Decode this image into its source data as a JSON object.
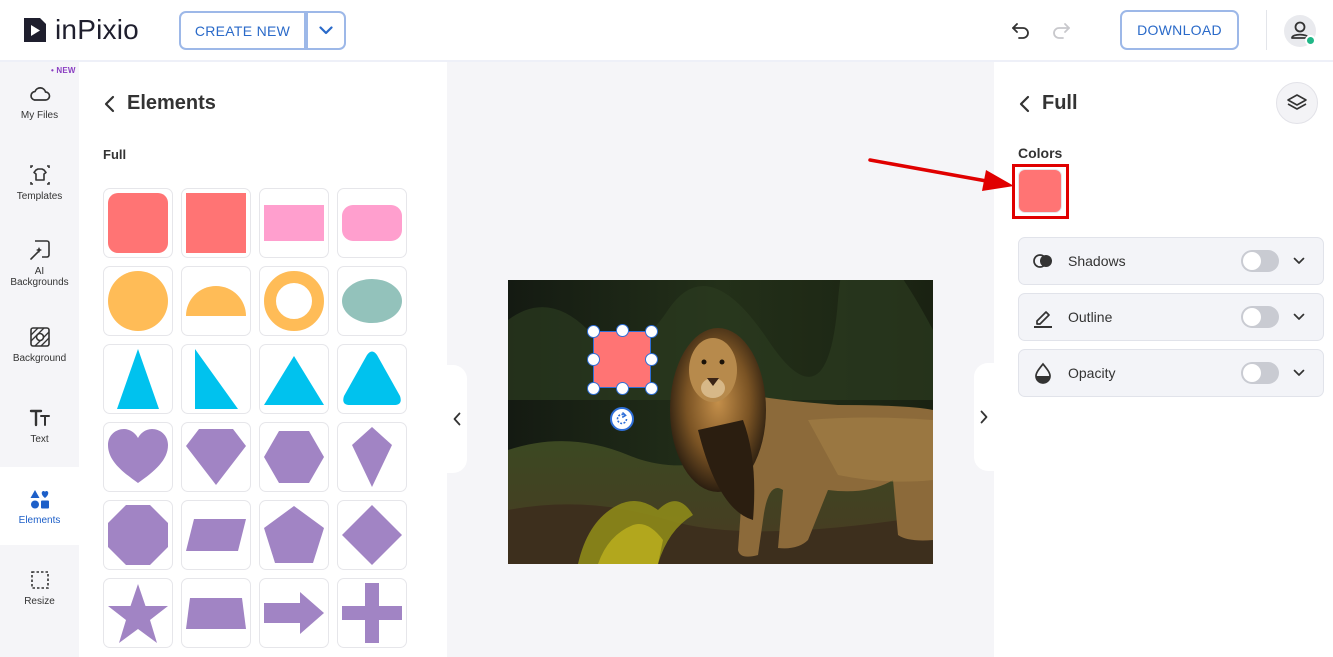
{
  "app": {
    "name": "inPixio"
  },
  "header": {
    "create_new_label": "CREATE NEW",
    "download_label": "DOWNLOAD"
  },
  "rail": {
    "new_badge": "• NEW",
    "items": [
      {
        "label": "My Files",
        "icon": "cloud-icon"
      },
      {
        "label": "Templates",
        "icon": "template-shirt-icon"
      },
      {
        "label": "AI Backgrounds",
        "icon": "ai-background-icon"
      },
      {
        "label": "Background",
        "icon": "background-icon"
      },
      {
        "label": "Text",
        "icon": "text-icon"
      },
      {
        "label": "Elements",
        "icon": "shapes-icon",
        "active": true
      },
      {
        "label": "Resize",
        "icon": "resize-icon"
      }
    ]
  },
  "elements_panel": {
    "title": "Elements",
    "section": "Full"
  },
  "props_panel": {
    "title": "Full",
    "colors_label": "Colors",
    "selected_color": "#ff7474",
    "options": [
      {
        "label": "Shadows",
        "enabled": false
      },
      {
        "label": "Outline",
        "enabled": false
      },
      {
        "label": "Opacity",
        "enabled": false
      }
    ]
  },
  "colors": {
    "accent": "#2a6ac9",
    "coral": "#ff7474",
    "pink": "#ff9fce",
    "orange": "#ffbc57",
    "teal": "#93c2bb",
    "cyan": "#00c2ee",
    "purple": "#a184c4",
    "highlight": "#e00000"
  }
}
